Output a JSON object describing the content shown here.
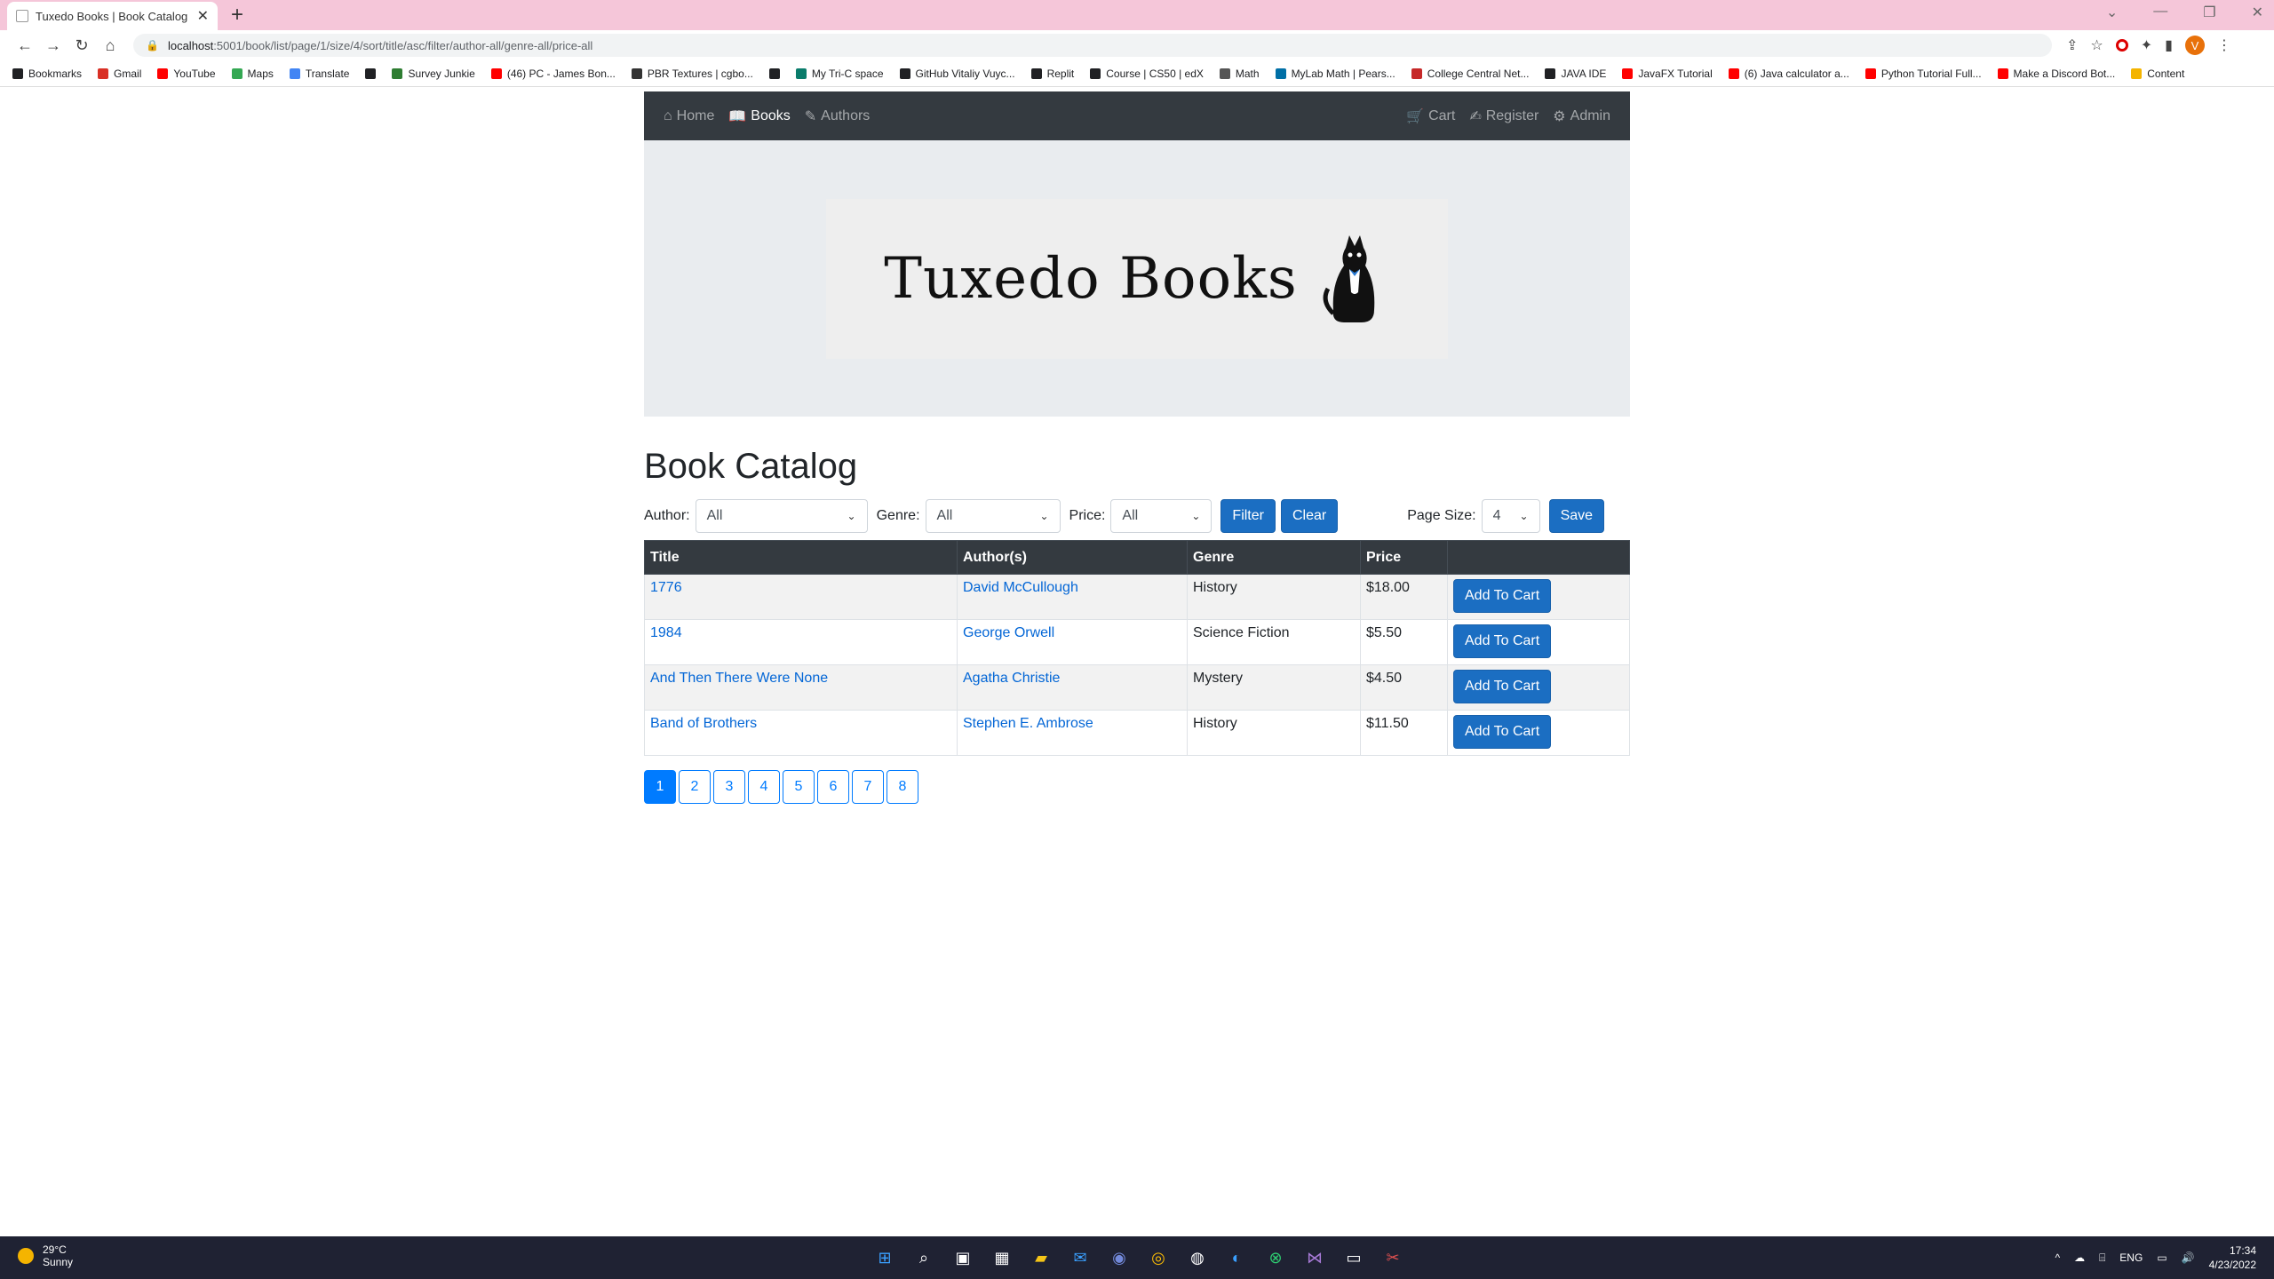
{
  "browser": {
    "tab_title": "Tuxedo Books | Book Catalog",
    "url_host": "localhost",
    "url_rest": ":5001/book/list/page/1/size/4/sort/title/asc/filter/author-all/genre-all/price-all",
    "profile_initial": "V",
    "bookmarks": [
      {
        "label": "Bookmarks",
        "color": "#202124"
      },
      {
        "label": "Gmail",
        "color": "#d93025"
      },
      {
        "label": "YouTube",
        "color": "#ff0000"
      },
      {
        "label": "Maps",
        "color": "#34a853"
      },
      {
        "label": "Translate",
        "color": "#4285f4"
      },
      {
        "label": "",
        "color": "#202124"
      },
      {
        "label": "Survey Junkie",
        "color": "#2e7d32"
      },
      {
        "label": "(46) PC - James Bon...",
        "color": "#ff0000"
      },
      {
        "label": "PBR Textures | cgbo...",
        "color": "#333333"
      },
      {
        "label": "",
        "color": "#202124"
      },
      {
        "label": "My Tri-C space",
        "color": "#0a7c6b"
      },
      {
        "label": "GitHub Vitaliy Vuyc...",
        "color": "#202124"
      },
      {
        "label": "Replit",
        "color": "#202124"
      },
      {
        "label": "Course | CS50 | edX",
        "color": "#202124"
      },
      {
        "label": "Math",
        "color": "#555555"
      },
      {
        "label": "MyLab Math | Pears...",
        "color": "#006fa6"
      },
      {
        "label": "College Central Net...",
        "color": "#c62828"
      },
      {
        "label": "JAVA IDE",
        "color": "#202124"
      },
      {
        "label": "JavaFX Tutorial",
        "color": "#ff0000"
      },
      {
        "label": "(6) Java calculator a...",
        "color": "#ff0000"
      },
      {
        "label": "Python Tutorial Full...",
        "color": "#ff0000"
      },
      {
        "label": "Make a Discord Bot...",
        "color": "#ff0000"
      },
      {
        "label": "Content",
        "color": "#f4b400"
      }
    ]
  },
  "nav": {
    "home": "Home",
    "books": "Books",
    "authors": "Authors",
    "cart": "Cart",
    "register": "Register",
    "admin": "Admin"
  },
  "banner": {
    "logo_text": "Tuxedo Books"
  },
  "catalog": {
    "title": "Book Catalog",
    "filters": {
      "author_label": "Author:",
      "author_value": "All",
      "genre_label": "Genre:",
      "genre_value": "All",
      "price_label": "Price:",
      "price_value": "All",
      "filter_button": "Filter",
      "clear_button": "Clear",
      "page_size_label": "Page Size:",
      "page_size_value": "4",
      "save_button": "Save"
    },
    "columns": [
      "Title",
      "Author(s)",
      "Genre",
      "Price",
      ""
    ],
    "rows": [
      {
        "title": "1776",
        "author": "David McCullough",
        "genre": "History",
        "price": "$18.00",
        "action": "Add To Cart"
      },
      {
        "title": "1984",
        "author": "George Orwell",
        "genre": "Science Fiction",
        "price": "$5.50",
        "action": "Add To Cart"
      },
      {
        "title": "And Then There Were None",
        "author": "Agatha Christie",
        "genre": "Mystery",
        "price": "$4.50",
        "action": "Add To Cart"
      },
      {
        "title": "Band of Brothers",
        "author": "Stephen E. Ambrose",
        "genre": "History",
        "price": "$11.50",
        "action": "Add To Cart"
      }
    ],
    "pages": [
      "1",
      "2",
      "3",
      "4",
      "5",
      "6",
      "7",
      "8"
    ],
    "current_page": "1"
  },
  "taskbar": {
    "temperature": "29°C",
    "weather": "Sunny",
    "language": "ENG",
    "time": "17:34",
    "date": "4/23/2022"
  }
}
